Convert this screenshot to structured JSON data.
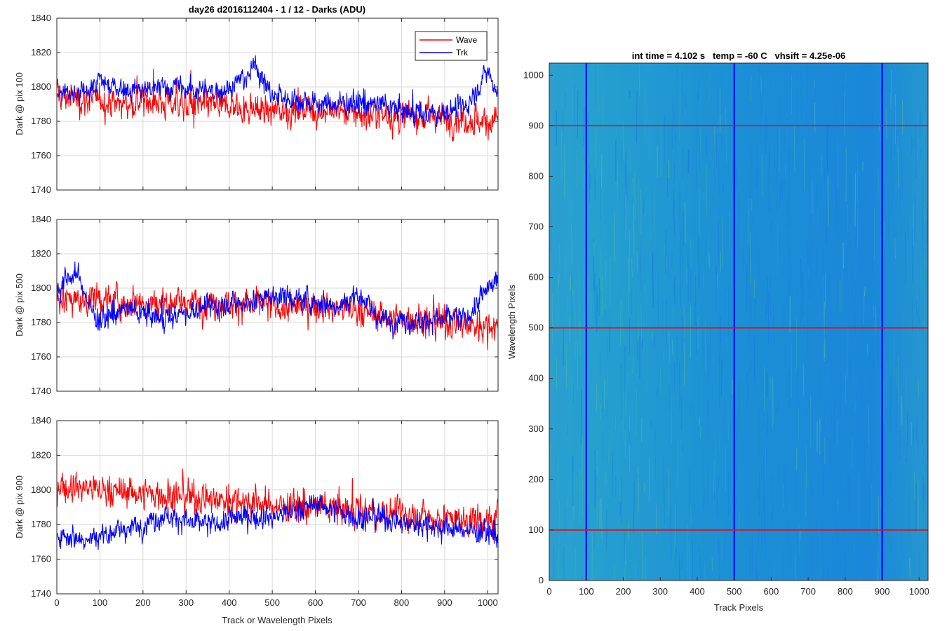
{
  "figure_title": "day26 d2016112404 - 1 / 12 - Darks (ADU)",
  "colors": {
    "wave": "#ff0000",
    "trk": "#0000ff"
  },
  "chart_data": [
    {
      "type": "line",
      "ylabel": "Dark @ pix 100",
      "xlabel": "",
      "xlim": [
        0,
        1024
      ],
      "ylim": [
        1740,
        1840
      ],
      "xticks": [
        0,
        100,
        200,
        300,
        400,
        500,
        600,
        700,
        800,
        900,
        1000
      ],
      "yticks": [
        1740,
        1760,
        1780,
        1800,
        1820,
        1840
      ],
      "grid": true,
      "legend": {
        "placement": "top-right",
        "entries": [
          "Wave",
          "Trk"
        ]
      },
      "series": [
        {
          "name": "Wave",
          "color": "#ff0000",
          "x": [
            0,
            50,
            100,
            150,
            200,
            250,
            300,
            350,
            400,
            450,
            500,
            550,
            600,
            650,
            700,
            750,
            800,
            850,
            900,
            950,
            1000,
            1024
          ],
          "y": [
            1795,
            1793,
            1792,
            1790,
            1792,
            1791,
            1790,
            1789,
            1788,
            1787,
            1786,
            1786,
            1787,
            1786,
            1785,
            1784,
            1783,
            1783,
            1782,
            1781,
            1780,
            1781
          ]
        },
        {
          "name": "Trk",
          "color": "#0000ff",
          "x": [
            0,
            50,
            100,
            150,
            200,
            250,
            300,
            350,
            400,
            450,
            460,
            470,
            500,
            550,
            600,
            650,
            700,
            750,
            800,
            850,
            900,
            950,
            980,
            1000,
            1024
          ],
          "y": [
            1796,
            1795,
            1803,
            1799,
            1798,
            1800,
            1799,
            1797,
            1800,
            1807,
            1817,
            1808,
            1795,
            1793,
            1791,
            1790,
            1791,
            1790,
            1786,
            1784,
            1785,
            1789,
            1800,
            1810,
            1797
          ]
        }
      ]
    },
    {
      "type": "line",
      "ylabel": "Dark @ pix 500",
      "xlabel": "",
      "xlim": [
        0,
        1024
      ],
      "ylim": [
        1740,
        1840
      ],
      "xticks": [
        0,
        100,
        200,
        300,
        400,
        500,
        600,
        700,
        800,
        900,
        1000
      ],
      "yticks": [
        1740,
        1760,
        1780,
        1800,
        1820,
        1840
      ],
      "grid": true,
      "series": [
        {
          "name": "Wave",
          "color": "#ff0000",
          "x": [
            0,
            50,
            100,
            150,
            200,
            250,
            300,
            350,
            400,
            450,
            500,
            550,
            600,
            650,
            700,
            750,
            800,
            850,
            900,
            950,
            1000,
            1024
          ],
          "y": [
            1795,
            1793,
            1794,
            1792,
            1793,
            1792,
            1792,
            1791,
            1791,
            1790,
            1789,
            1789,
            1790,
            1788,
            1787,
            1784,
            1782,
            1781,
            1780,
            1779,
            1777,
            1778
          ]
        },
        {
          "name": "Trk",
          "color": "#0000ff",
          "x": [
            0,
            25,
            50,
            75,
            100,
            150,
            200,
            250,
            300,
            350,
            400,
            450,
            500,
            550,
            600,
            650,
            700,
            750,
            800,
            850,
            900,
            950,
            1000,
            1024
          ],
          "y": [
            1798,
            1806,
            1808,
            1790,
            1780,
            1788,
            1785,
            1782,
            1786,
            1789,
            1791,
            1793,
            1796,
            1794,
            1793,
            1790,
            1797,
            1782,
            1781,
            1781,
            1782,
            1782,
            1800,
            1804
          ]
        }
      ]
    },
    {
      "type": "line",
      "ylabel": "Dark @ pix 900",
      "xlabel": "Track or Wavelength Pixels",
      "xlim": [
        0,
        1024
      ],
      "ylim": [
        1740,
        1840
      ],
      "xticks": [
        0,
        100,
        200,
        300,
        400,
        500,
        600,
        700,
        800,
        900,
        1000
      ],
      "yticks": [
        1740,
        1760,
        1780,
        1800,
        1820,
        1840
      ],
      "grid": true,
      "series": [
        {
          "name": "Wave",
          "color": "#ff0000",
          "x": [
            0,
            50,
            100,
            150,
            200,
            250,
            300,
            350,
            400,
            450,
            500,
            550,
            600,
            650,
            700,
            750,
            800,
            850,
            900,
            950,
            1000,
            1024
          ],
          "y": [
            1803,
            1802,
            1800,
            1799,
            1798,
            1797,
            1796,
            1795,
            1794,
            1793,
            1791,
            1790,
            1790,
            1789,
            1788,
            1787,
            1786,
            1785,
            1784,
            1783,
            1782,
            1783
          ]
        },
        {
          "name": "Trk",
          "color": "#0000ff",
          "x": [
            0,
            50,
            100,
            150,
            200,
            250,
            300,
            350,
            400,
            450,
            500,
            550,
            600,
            650,
            700,
            750,
            800,
            850,
            900,
            950,
            1000,
            1024
          ],
          "y": [
            1776,
            1772,
            1774,
            1777,
            1780,
            1786,
            1782,
            1779,
            1783,
            1785,
            1784,
            1788,
            1792,
            1788,
            1783,
            1784,
            1781,
            1780,
            1778,
            1777,
            1775,
            1774
          ]
        }
      ]
    },
    {
      "type": "heatmap",
      "title": "int time = 4.102 s   temp = -60 C   vhsift = 4.25e-06",
      "xlabel": "Track Pixels",
      "ylabel": "Wavelength Pixels",
      "xlim": [
        0,
        1024
      ],
      "ylim": [
        0,
        1024
      ],
      "xticks": [
        0,
        100,
        200,
        300,
        400,
        500,
        600,
        700,
        800,
        900,
        1000
      ],
      "yticks": [
        0,
        100,
        200,
        300,
        400,
        500,
        600,
        700,
        800,
        900,
        1000
      ],
      "colormap": "parula",
      "base_color": "#1f90d2",
      "overlay": {
        "vertical_lines_x": [
          100,
          500,
          900
        ],
        "vertical_color": "#0000ff",
        "horizontal_lines_y": [
          100,
          500,
          900
        ],
        "horizontal_color": "#ff0000"
      }
    }
  ]
}
